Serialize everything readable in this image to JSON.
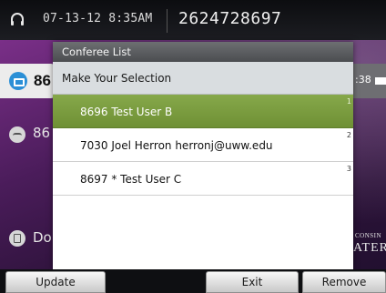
{
  "header": {
    "datetime": "07-13-12 8:35AM",
    "phone_number": "2624728697"
  },
  "background_lines": [
    {
      "label": "86"
    },
    {
      "label": "86"
    },
    {
      "label": "Do"
    }
  ],
  "right_partial_text": ":38",
  "logo": {
    "line1": "CONSIN",
    "line2": "ATER"
  },
  "dialog": {
    "title": "Conferee List",
    "prompt": "Make Your Selection",
    "items": [
      {
        "text": "8696 Test User B",
        "index": "1",
        "selected": true
      },
      {
        "text": "7030 Joel Herron herronj@uww.edu",
        "index": "2",
        "selected": false
      },
      {
        "text": "8697 * Test User C",
        "index": "3",
        "selected": false
      }
    ]
  },
  "softkeys": {
    "update": "Update",
    "exit": "Exit",
    "remove": "Remove"
  },
  "colors": {
    "selected_row": "#7a9c3f",
    "wallpaper": "#4a1c5a",
    "line_icon_blue": "#2b8fd6"
  }
}
